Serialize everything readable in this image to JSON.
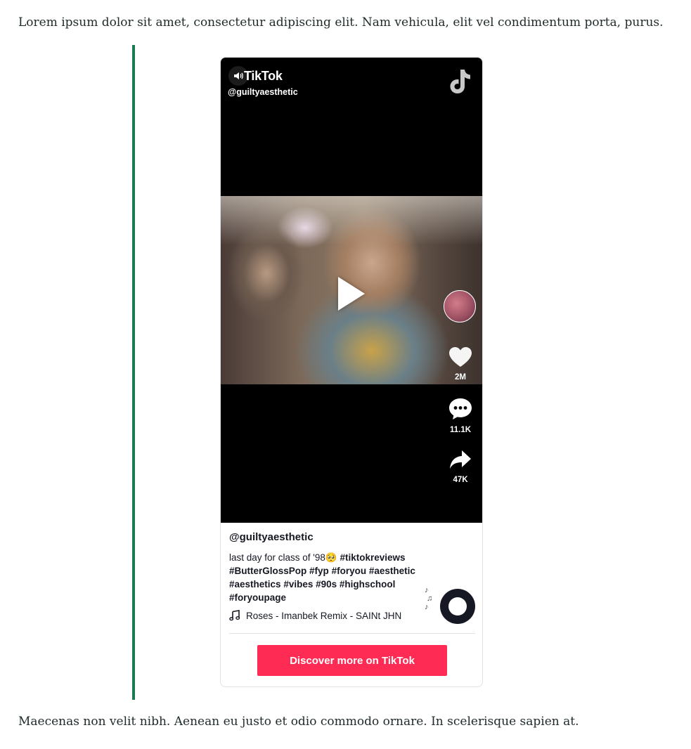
{
  "article": {
    "paragraph_top": "Lorem ipsum dolor sit amet, consectetur adipiscing elit. Nam vehicula, elit vel condimentum porta, purus.",
    "paragraph_bottom": "Maecenas non velit nibh. Aenean eu justo et odio commodo ornare. In scelerisque sapien at."
  },
  "embed": {
    "brand": "TikTok",
    "handle": "@guiltyaesthetic",
    "author": "@guiltyaesthetic",
    "caption": "last day for class of '98🥺",
    "hashtags": [
      "#tiktokreviews",
      "#ButterGlossPop",
      "#fyp",
      "#foryou",
      "#aesthetic",
      "#aesthetics",
      "#vibes",
      "#90s",
      "#highschool",
      "#foryoupage"
    ],
    "sound": "Roses - Imanbek Remix - SAINt JHN",
    "likes": "2M",
    "comments": "11.1K",
    "shares": "47K",
    "cta_label": "Discover more on TikTok",
    "accent_color": "#fe2c55",
    "quote_bar_color": "#1c7a52",
    "icons": [
      "sound-icon",
      "tiktok-logo-icon",
      "play-icon",
      "heart-icon",
      "comment-icon",
      "share-icon",
      "music-note-icon",
      "music-disc-icon"
    ]
  }
}
